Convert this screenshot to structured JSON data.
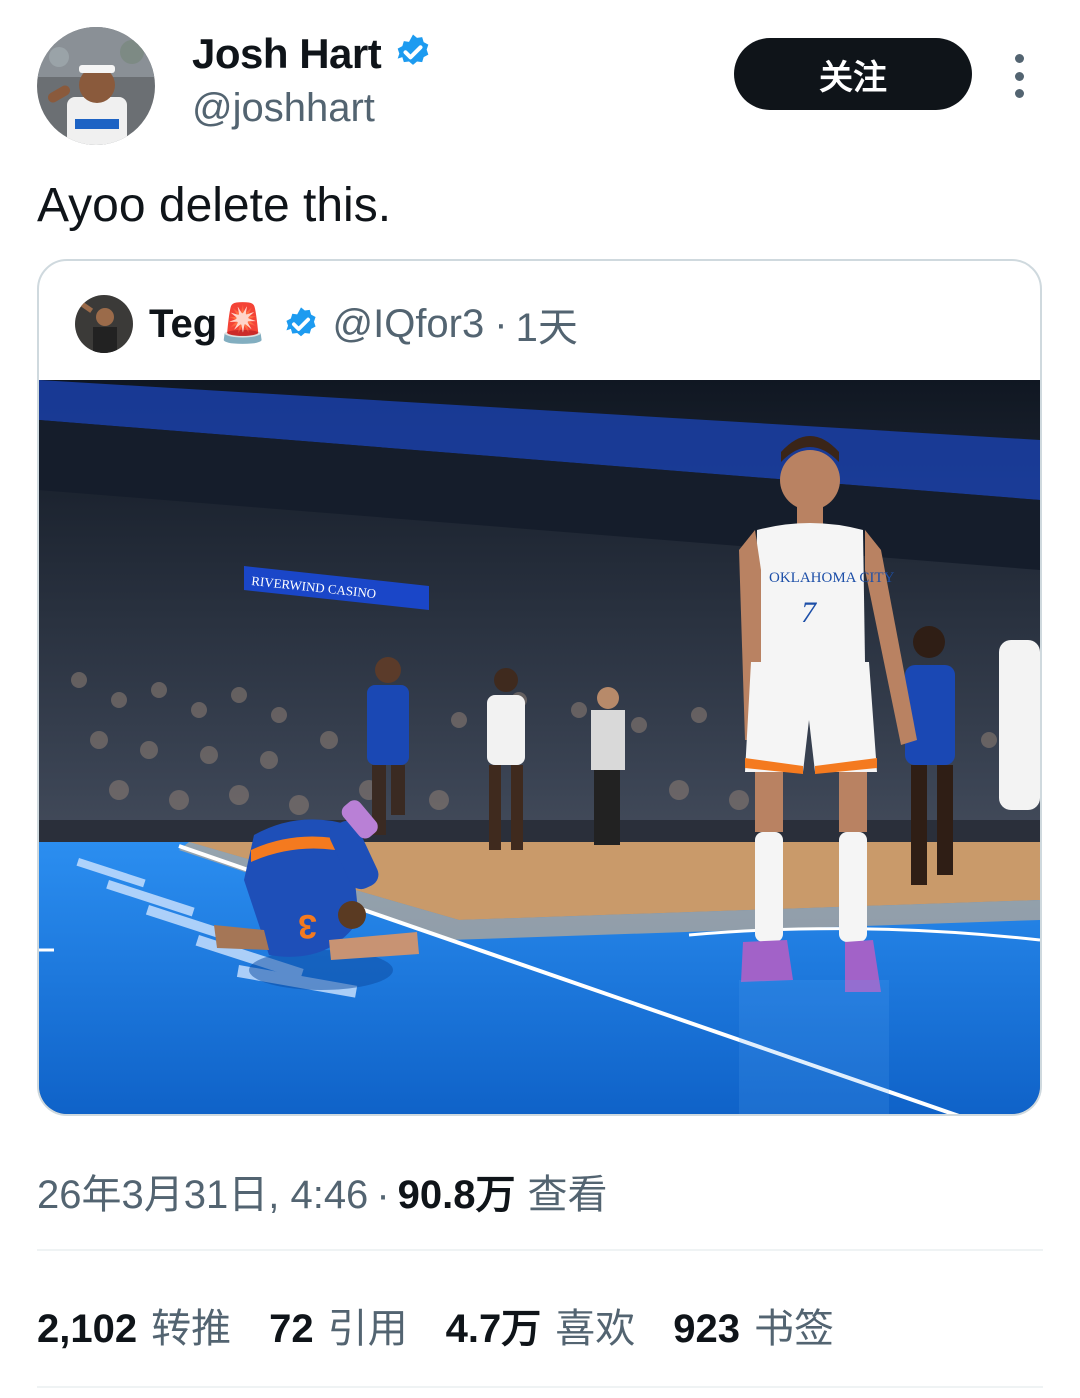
{
  "author": {
    "name": "Josh Hart",
    "handle": "@joshhart",
    "verified": true
  },
  "follow_label": "关注",
  "tweet_text": "Ayoo delete this.",
  "quoted": {
    "name": "Teg",
    "emoji": "🚨",
    "handle": "@IQfor3",
    "separator": "·",
    "age": "1天",
    "verified": true,
    "media": {
      "arena_sign": "RIVERWIND CASINO",
      "jersey_white": "OKLAHOMA CITY",
      "jersey_white_number": "7",
      "jersey_blue_number": "3"
    }
  },
  "meta": {
    "date_time": "26年3月31日, 4:46",
    "separator": "·",
    "views": "90.8万",
    "views_label": "查看"
  },
  "stats": [
    {
      "value": "2,102",
      "label": "转推"
    },
    {
      "value": "72",
      "label": "引用"
    },
    {
      "value": "4.7万",
      "label": "喜欢"
    },
    {
      "value": "923",
      "label": "书签"
    }
  ],
  "colors": {
    "verified_badge": "#1d9bf0",
    "court_blue": "#1f7fe0",
    "text_primary": "#0f1419",
    "text_secondary": "#536471"
  }
}
